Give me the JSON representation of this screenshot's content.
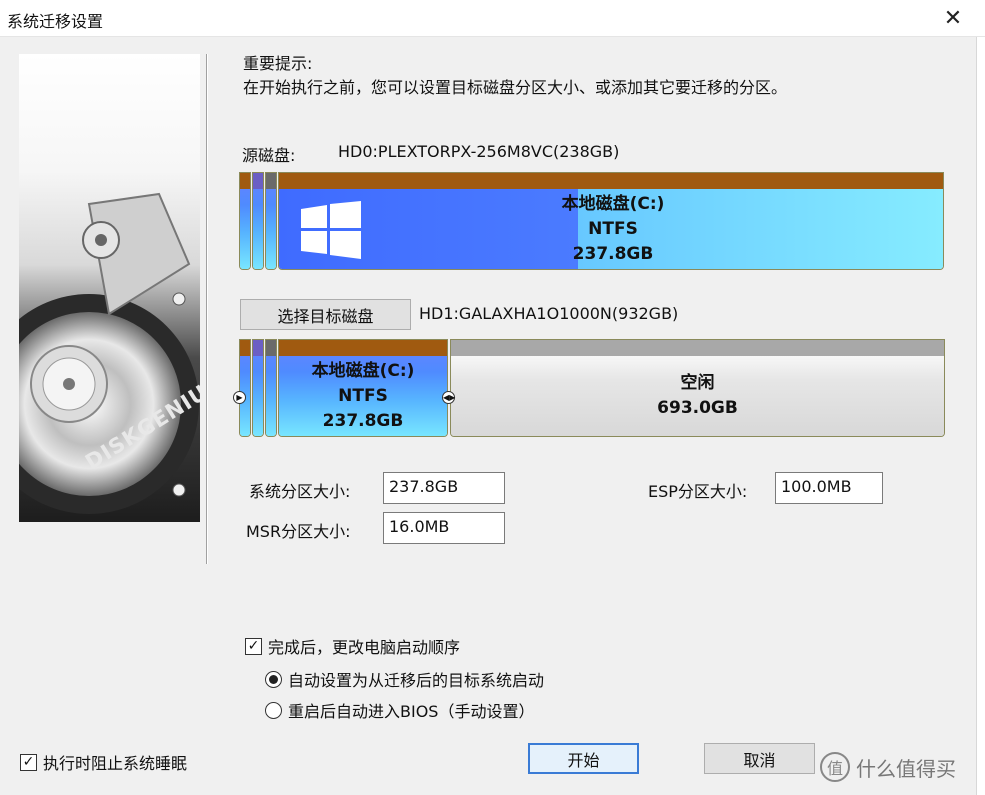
{
  "window": {
    "title": "系统迁移设置",
    "close_glyph": "✕"
  },
  "banner": {
    "logo_text": "DISKGENIUS"
  },
  "notice": {
    "title": "重要提示:",
    "body": "在开始执行之前，您可以设置目标磁盘分区大小、或添加其它要迁移的分区。"
  },
  "source": {
    "label": "源磁盘:",
    "disk_name": "HD0:PLEXTORPX-256M8VC(238GB)",
    "partitions": [
      {
        "name": "本地磁盘(C:)",
        "fs": "NTFS",
        "size": "237.8GB"
      }
    ]
  },
  "target": {
    "select_button": "选择目标磁盘",
    "disk_name": "HD1:GALAXHA1O1000N(932GB)",
    "partitions": [
      {
        "name": "本地磁盘(C:)",
        "fs": "NTFS",
        "size": "237.8GB"
      },
      {
        "name": "空闲",
        "size": "693.0GB"
      }
    ]
  },
  "sizes": {
    "system_label": "系统分区大小:",
    "system_value": "237.8GB",
    "esp_label": "ESP分区大小:",
    "esp_value": "100.0MB",
    "msr_label": "MSR分区大小:",
    "msr_value": "16.0MB"
  },
  "options": {
    "change_boot_label": "完成后，更改电脑启动顺序",
    "change_boot_checked": true,
    "auto_boot_label": "自动设置为从迁移后的目标系统启动",
    "auto_boot_selected": true,
    "bios_label": "重启后自动进入BIOS（手动设置）",
    "bios_selected": false
  },
  "footer": {
    "prevent_sleep_label": "执行时阻止系统睡眠",
    "prevent_sleep_checked": true,
    "start_button": "开始",
    "cancel_button": "取消"
  },
  "watermark": {
    "text": "什么值得买",
    "glyph": "值"
  },
  "colors": {
    "partition_top": "#a05a10",
    "partition_blue": "#57b4ff",
    "free_grey": "#dcdcdc",
    "default_button_border": "#3a7bd5"
  }
}
